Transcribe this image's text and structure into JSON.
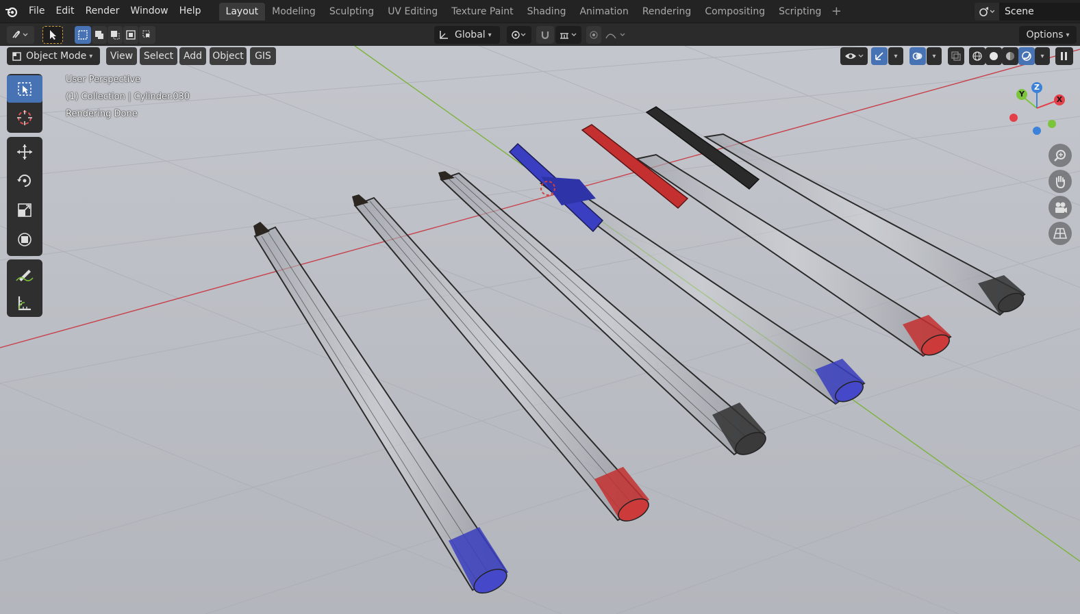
{
  "menubar": {
    "items": [
      "File",
      "Edit",
      "Render",
      "Window",
      "Help"
    ],
    "workspaces": [
      "Layout",
      "Modeling",
      "Sculpting",
      "UV Editing",
      "Texture Paint",
      "Shading",
      "Animation",
      "Rendering",
      "Compositing",
      "Scripting"
    ],
    "active_workspace": "Layout",
    "add_tab": "+",
    "scene_name": "Scene"
  },
  "toolbar": {
    "orientation": "Global",
    "options_label": "Options"
  },
  "viewport_header": {
    "mode": "Object Mode",
    "menus": [
      "View",
      "Select",
      "Add",
      "Object",
      "GIS"
    ]
  },
  "overlay": {
    "view_name": "User Perspective",
    "collection": "(1) Collection | Cylinder.030",
    "status": "Rendering Done"
  },
  "gizmo": {
    "axes": [
      "Y",
      "Z",
      "X"
    ],
    "colors": {
      "x": "#e4404a",
      "y": "#7cc43c",
      "z": "#3b82d8"
    }
  },
  "tools": [
    "select-box-tool",
    "cursor-tool",
    "move-tool",
    "rotate-tool",
    "scale-tool",
    "transform-tool",
    "annotate-tool",
    "measure-tool"
  ],
  "colors": {
    "accent": "#4772b3",
    "pen_blue": "#3a3ec0",
    "pen_red": "#c43030",
    "pen_black": "#222222",
    "x_axis": "#c8404a",
    "y_axis": "#7db23c"
  }
}
